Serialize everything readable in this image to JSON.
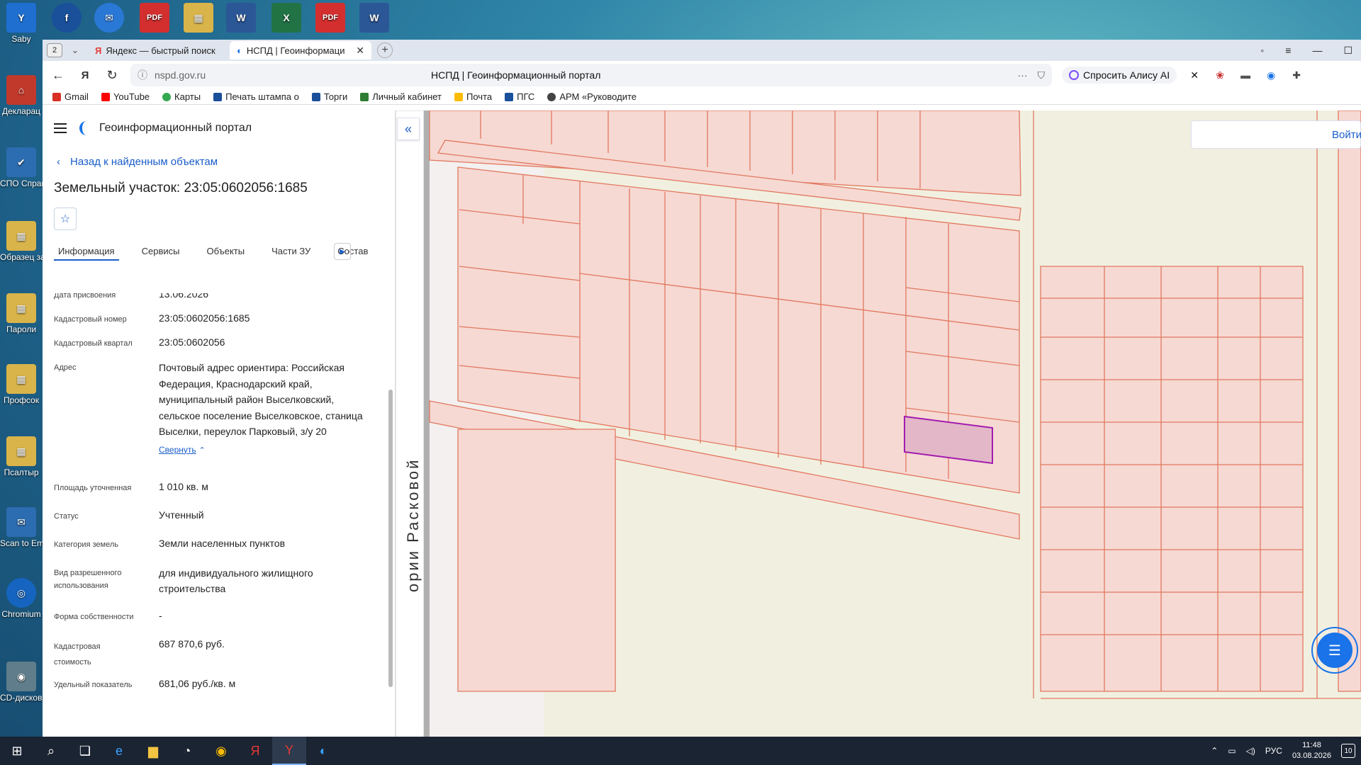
{
  "desktop": {
    "top_icons": [
      {
        "label": "Saby",
        "color": "#1f6fd1",
        "glyph": "Y"
      },
      {
        "label": "",
        "color": "#1a4f9a",
        "glyph": "f"
      },
      {
        "label": "",
        "color": "#2a78d6",
        "glyph": "✉"
      },
      {
        "label": "",
        "color": "#d32f2f",
        "glyph": "PDF"
      },
      {
        "label": "",
        "color": "#d9b44a",
        "glyph": "▦"
      },
      {
        "label": "",
        "color": "#2b5797",
        "glyph": "W"
      },
      {
        "label": "",
        "color": "#217346",
        "glyph": "X"
      },
      {
        "label": "",
        "color": "#d32f2f",
        "glyph": "PDF"
      },
      {
        "label": "",
        "color": "#2b5797",
        "glyph": "W"
      }
    ],
    "side_icons": [
      {
        "label": "Декларац",
        "color": "#c0392b",
        "glyph": "⌂"
      },
      {
        "label": "СПО Справки Б",
        "color": "#2c6cb0",
        "glyph": "✔"
      },
      {
        "label": "Образец заявлени",
        "color": "#d9b44a",
        "glyph": "▦"
      },
      {
        "label": "Пароли",
        "color": "#d9b44a",
        "glyph": "▦"
      },
      {
        "label": "Профсок",
        "color": "#d9b44a",
        "glyph": "▦"
      },
      {
        "label": "Псалтыр",
        "color": "#d9b44a",
        "glyph": "▦"
      },
      {
        "label": "Scan to Em",
        "color": "#2c6cb0",
        "glyph": "✉"
      },
      {
        "label": "Chromium",
        "color": "#1565c0",
        "glyph": "◎"
      },
      {
        "label": "CD-дисков - Ярлык",
        "color": "#607d8b",
        "glyph": "◉"
      }
    ]
  },
  "browser": {
    "tab_count": "2",
    "tabs": [
      {
        "label": "Яндекс — быстрый поиск",
        "icon": "yandex-icon",
        "active": false
      },
      {
        "label": "НСПД | Геоинформаци",
        "icon": "nspd-icon",
        "active": true
      }
    ],
    "url_host": "nspd.gov.ru",
    "page_title": "НСПД | Геоинформационный портал",
    "alice_label": "Спросить Алису AI",
    "bookmarks": [
      {
        "label": "Gmail",
        "color": "#d93025"
      },
      {
        "label": "YouTube",
        "color": "#ff0000"
      },
      {
        "label": "Карты",
        "color": "#34a853"
      },
      {
        "label": "Печать штампа о",
        "color": "#1a4f9a"
      },
      {
        "label": "Торги",
        "color": "#1a4f9a"
      },
      {
        "label": "Личный кабинет",
        "color": "#2e7d32"
      },
      {
        "label": "Почта",
        "color": "#fbbc04"
      },
      {
        "label": "ПГС",
        "color": "#1a4f9a"
      },
      {
        "label": "АРМ «Руководите",
        "color": "#444444"
      }
    ]
  },
  "portal": {
    "name": "Геоинформационный портал",
    "back_label": "Назад к найденным объектам",
    "title": "Земельный участок: 23:05:0602056:1685",
    "tabs": [
      "Информация",
      "Сервисы",
      "Объекты",
      "Части ЗУ",
      "Состав"
    ],
    "properties": [
      {
        "key": "Дата присвоения",
        "value": "13.06.2026"
      },
      {
        "key": "Кадастровый номер",
        "value": "23:05:0602056:1685"
      },
      {
        "key": "Кадастровый квартал",
        "value": "23:05:0602056"
      },
      {
        "key": "Адрес",
        "value": "Почтовый адрес ориентира: Российская Федерация, Краснодарский край, муниципальный район Выселковский, сельское поселение Выселковское, станица Выселки, переулок Парковый, з/у 20"
      },
      {
        "key": "Площадь уточненная",
        "value": "1 010 кв. м"
      },
      {
        "key": "Статус",
        "value": "Учтенный"
      },
      {
        "key": "Категория земель",
        "value": "Земли населенных пунктов"
      },
      {
        "key": "Вид разрешенного использования",
        "value": "для индивидуального жилищного строительства"
      },
      {
        "key": "Форма собственности",
        "value": "-"
      },
      {
        "key": "Кадастровая стоимость",
        "value": "687 870,6 руб."
      },
      {
        "key": "Удельный показатель",
        "value": "681,06 руб./кв. м"
      }
    ],
    "collapse_label": "Свернуть"
  },
  "map": {
    "login_label": "Войти",
    "street_label": "ории Расковой",
    "parcel_stroke": "#e07a5f",
    "selected_fill": "#e3b7c8",
    "selected_stroke": "#a21caf"
  },
  "taskbar": {
    "lang": "РУС",
    "time": "11:48",
    "date": "03.08.2026",
    "notifications": "10"
  }
}
